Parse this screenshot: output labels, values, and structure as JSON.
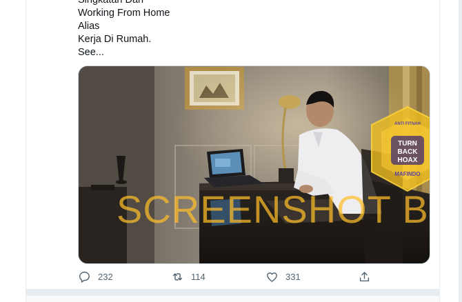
{
  "tweet": {
    "lines": [
      "Singkatan Dari",
      "Working From Home",
      "Alias",
      "Kerja Di Rumah.",
      "See..."
    ]
  },
  "watermark": {
    "text": "SCREENSHOT BY",
    "badge_top_text": "MASYARAKAT ANTI FITNAH INDONESIA",
    "badge_center_text": "TURN BACK HOAX",
    "badge_bottom_text": "MAFINDO",
    "color": "#f5b921"
  },
  "actions": {
    "reply_count": "232",
    "retweet_count": "114",
    "like_count": "331"
  },
  "colors": {
    "icon_gray": "#536471",
    "border": "#e6ecf0"
  }
}
